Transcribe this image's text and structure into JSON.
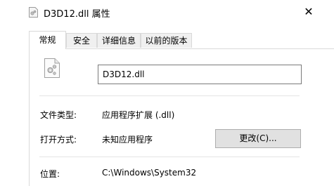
{
  "window": {
    "title": "D3D12.dll 属性",
    "icons": {
      "title": "dll-file-icon",
      "close": "close-icon"
    },
    "close_label": "✕"
  },
  "tabs": [
    {
      "label": "常规",
      "active": true
    },
    {
      "label": "安全",
      "active": false
    },
    {
      "label": "详细信息",
      "active": false
    },
    {
      "label": "以前的版本",
      "active": false
    }
  ],
  "general": {
    "file_icon": "gear-file-icon",
    "filename": "D3D12.dll",
    "file_type_label": "文件类型:",
    "file_type_value": "应用程序扩展 (.dll)",
    "opens_with_label": "打开方式:",
    "opens_with_value": "未知应用程序",
    "change_button": "更改(C)...",
    "location_label": "位置:",
    "location_value": "C:\\Windows\\System32"
  }
}
